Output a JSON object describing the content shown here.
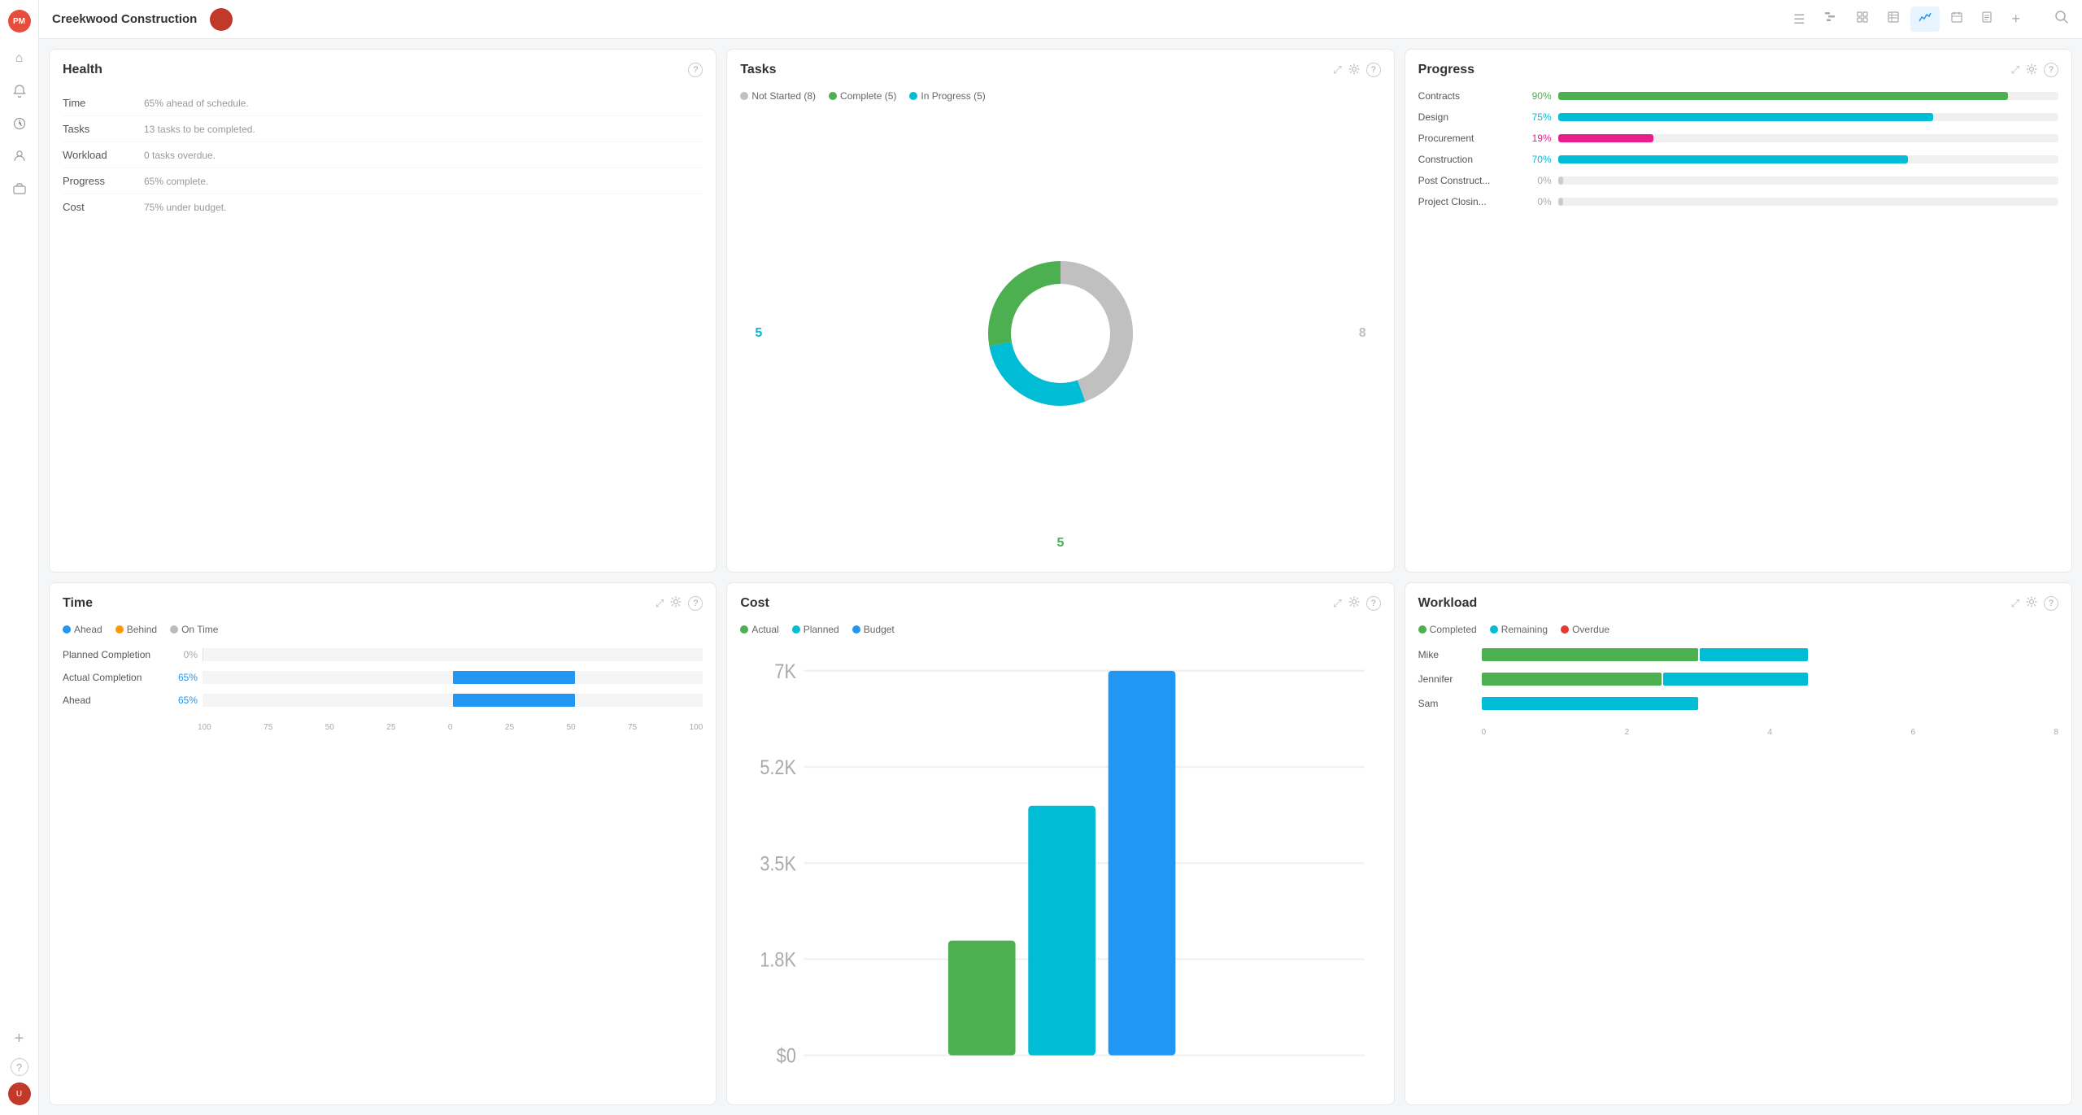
{
  "app": {
    "logo": "PM",
    "title": "Creekwood Construction"
  },
  "header": {
    "tabs": [
      {
        "id": "list",
        "icon": "☰",
        "active": false
      },
      {
        "id": "gantt",
        "icon": "▦",
        "active": false
      },
      {
        "id": "dash2",
        "icon": "⊟",
        "active": false
      },
      {
        "id": "table",
        "icon": "⊞",
        "active": false
      },
      {
        "id": "chart",
        "icon": "〜",
        "active": true
      },
      {
        "id": "cal",
        "icon": "▣",
        "active": false
      },
      {
        "id": "doc",
        "icon": "⬜",
        "active": false
      },
      {
        "id": "plus",
        "icon": "+",
        "active": false
      }
    ],
    "search_icon": "🔍"
  },
  "sidebar": {
    "items": [
      {
        "id": "home",
        "icon": "⌂",
        "active": false
      },
      {
        "id": "bell",
        "icon": "🔔",
        "active": false
      },
      {
        "id": "clock",
        "icon": "🕐",
        "active": false
      },
      {
        "id": "person",
        "icon": "👤",
        "active": false
      },
      {
        "id": "briefcase",
        "icon": "💼",
        "active": false
      }
    ],
    "bottom": [
      {
        "id": "add",
        "icon": "+",
        "label": "Add"
      },
      {
        "id": "help",
        "icon": "?",
        "label": "Help"
      },
      {
        "id": "avatar",
        "icon": "U",
        "label": "User"
      }
    ]
  },
  "health": {
    "title": "Health",
    "rows": [
      {
        "label": "Time",
        "value": "65% ahead of schedule."
      },
      {
        "label": "Tasks",
        "value": "13 tasks to be completed."
      },
      {
        "label": "Workload",
        "value": "0 tasks overdue."
      },
      {
        "label": "Progress",
        "value": "65% complete."
      },
      {
        "label": "Cost",
        "value": "75% under budget."
      }
    ]
  },
  "tasks": {
    "title": "Tasks",
    "legend": [
      {
        "label": "Not Started (8)",
        "color": "#c0c0c0"
      },
      {
        "label": "Complete (5)",
        "color": "#4caf50"
      },
      {
        "label": "In Progress (5)",
        "color": "#00bcd4"
      }
    ],
    "donut": {
      "not_started": 8,
      "complete": 5,
      "in_progress": 5,
      "label_left": "5",
      "label_right": "8",
      "label_bottom": "5"
    }
  },
  "progress": {
    "title": "Progress",
    "rows": [
      {
        "label": "Contracts",
        "pct": 90,
        "pct_label": "90%",
        "color": "#4caf50"
      },
      {
        "label": "Design",
        "pct": 75,
        "pct_label": "75%",
        "color": "#00bcd4"
      },
      {
        "label": "Procurement",
        "pct": 19,
        "pct_label": "19%",
        "color": "#e91e8c"
      },
      {
        "label": "Construction",
        "pct": 70,
        "pct_label": "70%",
        "color": "#00bcd4"
      },
      {
        "label": "Post Construct...",
        "pct": 0,
        "pct_label": "0%",
        "color": "#ccc"
      },
      {
        "label": "Project Closin...",
        "pct": 0,
        "pct_label": "0%",
        "color": "#ccc"
      }
    ]
  },
  "time": {
    "title": "Time",
    "legend": [
      {
        "label": "Ahead",
        "color": "#2196f3"
      },
      {
        "label": "Behind",
        "color": "#ff9800"
      },
      {
        "label": "On Time",
        "color": "#bbb"
      }
    ],
    "rows": [
      {
        "label": "Planned Completion",
        "value": "0%",
        "pct": 0,
        "has_bar": false
      },
      {
        "label": "Actual Completion",
        "value": "65%",
        "pct": 65,
        "has_bar": true
      },
      {
        "label": "Ahead",
        "value": "65%",
        "pct": 65,
        "has_bar": true
      }
    ],
    "x_axis": [
      "100",
      "75",
      "50",
      "25",
      "0",
      "25",
      "50",
      "75",
      "100"
    ]
  },
  "cost": {
    "title": "Cost",
    "legend": [
      {
        "label": "Actual",
        "color": "#4caf50"
      },
      {
        "label": "Planned",
        "color": "#00bcd4"
      },
      {
        "label": "Budget",
        "color": "#2196f3"
      }
    ],
    "y_labels": [
      "7K",
      "5.2K",
      "3.5K",
      "1.8K",
      "$0"
    ],
    "bars": [
      {
        "actual": 30,
        "planned": 65,
        "budget": 100
      }
    ]
  },
  "workload": {
    "title": "Workload",
    "legend": [
      {
        "label": "Completed",
        "color": "#4caf50"
      },
      {
        "label": "Remaining",
        "color": "#00bcd4"
      },
      {
        "label": "Overdue",
        "color": "#e53935"
      }
    ],
    "rows": [
      {
        "label": "Mike",
        "completed": 3,
        "remaining": 1.5,
        "overdue": 0
      },
      {
        "label": "Jennifer",
        "completed": 2.5,
        "remaining": 2,
        "overdue": 0
      },
      {
        "label": "Sam",
        "completed": 0,
        "remaining": 3,
        "overdue": 0
      }
    ],
    "x_axis": [
      "0",
      "2",
      "4",
      "6",
      "8"
    ]
  },
  "colors": {
    "green": "#4caf50",
    "cyan": "#00bcd4",
    "blue": "#2196f3",
    "pink": "#e91e8c",
    "gray": "#c0c0c0",
    "orange": "#ff9800",
    "red": "#e53935"
  }
}
